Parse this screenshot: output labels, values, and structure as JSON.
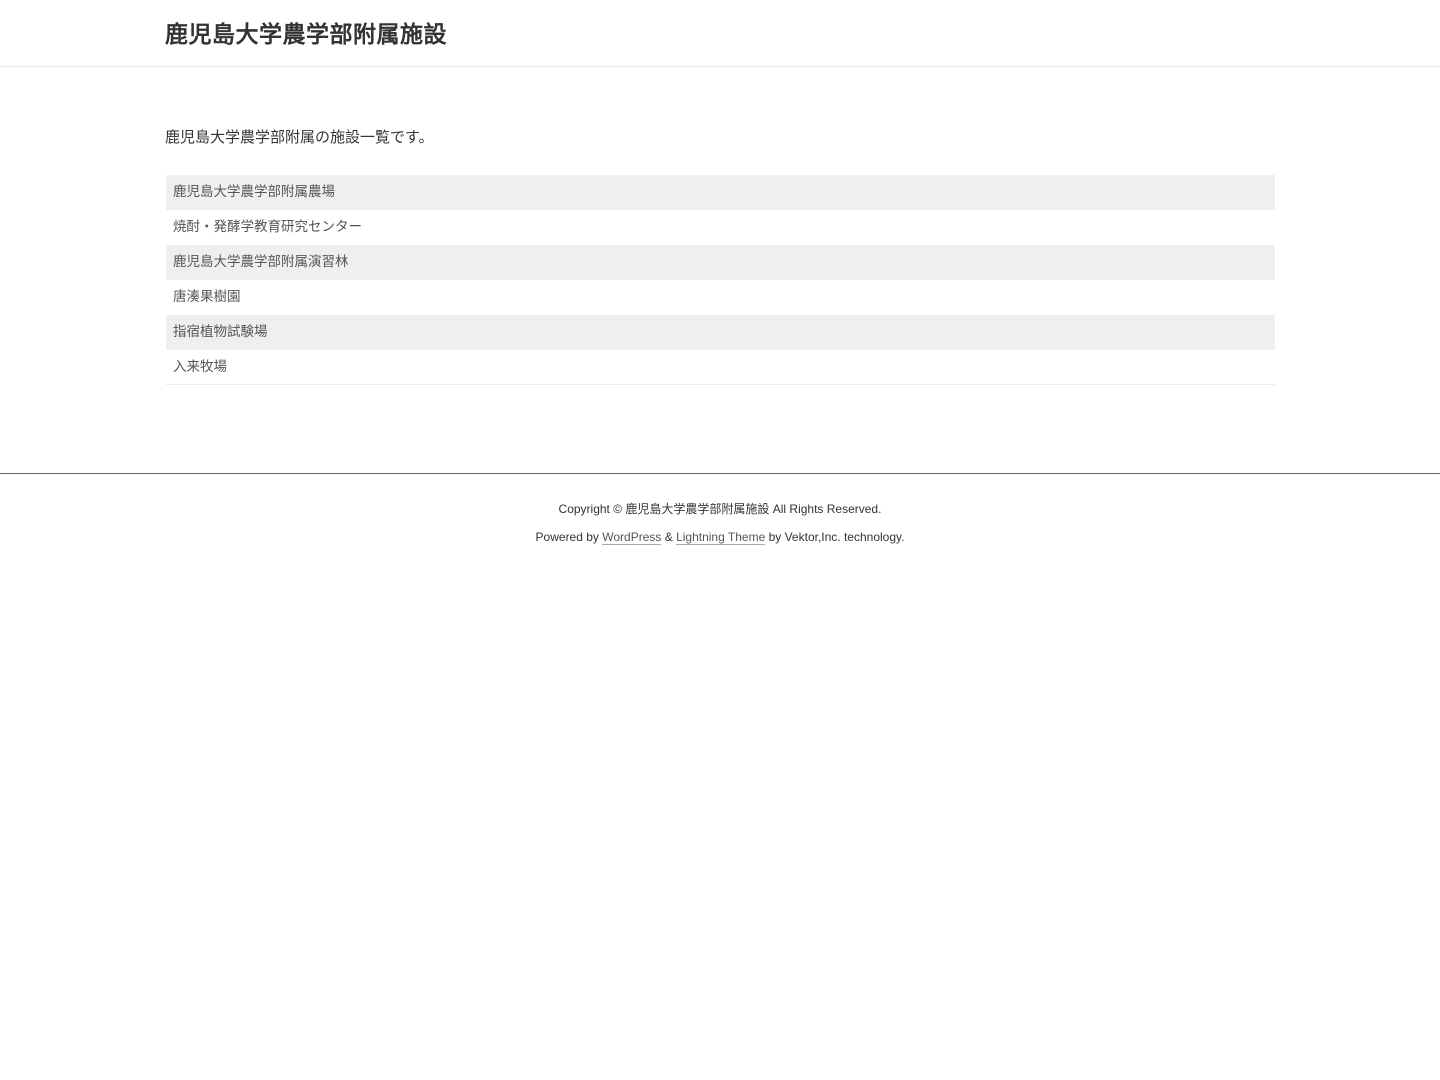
{
  "header": {
    "site_title": "鹿児島大学農学部附属施設"
  },
  "main": {
    "intro": "鹿児島大学農学部附属の施設一覧です。",
    "facilities": [
      "鹿児島大学農学部附属農場",
      "焼酎・発酵学教育研究センター",
      "鹿児島大学農学部附属演習林",
      "唐湊果樹園",
      "指宿植物試験場",
      "入来牧場"
    ]
  },
  "footer": {
    "copyright": "Copyright © 鹿児島大学農学部附属施設 All Rights Reserved.",
    "powered_prefix": "Powered by ",
    "wordpress_link": "WordPress",
    "and": " & ",
    "theme_link": "Lightning Theme",
    "powered_suffix": " by Vektor,Inc. technology."
  }
}
